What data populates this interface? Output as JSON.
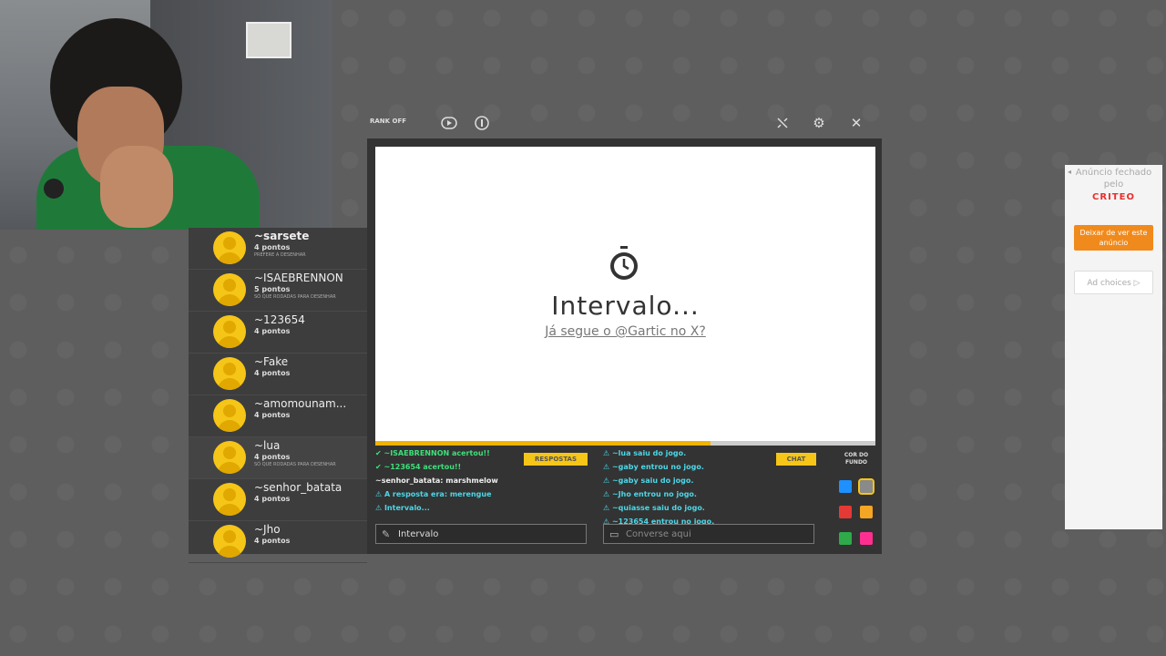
{
  "toolbar": {
    "label": "RANK OFF",
    "icons": [
      "video-icon",
      "info-icon",
      "minimize-icon",
      "gear-icon",
      "close-icon"
    ]
  },
  "players": [
    {
      "name": "~sarsete",
      "points": "4 pontos",
      "sub": "PREFERE A DESENHAR",
      "bold": true
    },
    {
      "name": "~ISAEBRENNON",
      "points": "5 pontos",
      "sub": "SÓ QUE RODADAS PARA DESENHAR"
    },
    {
      "name": "~123654",
      "points": "4 pontos",
      "sub": ""
    },
    {
      "name": "~Fake",
      "points": "4 pontos",
      "sub": ""
    },
    {
      "name": "~amomounam...",
      "points": "4 pontos",
      "sub": ""
    },
    {
      "name": "~lua",
      "points": "4 pontos",
      "sub": "SÓ QUE RODADAS PARA DESENHAR"
    },
    {
      "name": "~senhor_batata",
      "points": "4 pontos",
      "sub": ""
    },
    {
      "name": "~Jho",
      "points": "4 pontos",
      "sub": ""
    }
  ],
  "canvas": {
    "title": "Intervalo...",
    "link": "Já segue o @Gartic no X?",
    "progress_percent": 67
  },
  "answers": {
    "tab_label": "RESPOSTAS",
    "messages": [
      {
        "text": "✔ ~ISAEBRENNON acertou!!",
        "color": "green"
      },
      {
        "text": "✔ ~123654 acertou!!",
        "color": "green"
      },
      {
        "text": "~senhor_batata: marshmelow",
        "color": "white"
      },
      {
        "text": "⚠ A resposta era: merengue",
        "color": "cyan"
      },
      {
        "text": "⚠ Intervalo...",
        "color": "cyan"
      }
    ],
    "input_value": "Intervalo"
  },
  "chat": {
    "tab_label": "CHAT",
    "messages": [
      {
        "text": "⚠ ~lua saiu do jogo.",
        "color": "cyan"
      },
      {
        "text": "⚠ ~gaby entrou no jogo.",
        "color": "cyan"
      },
      {
        "text": "⚠ ~gaby saiu do jogo.",
        "color": "cyan"
      },
      {
        "text": "⚠ ~Jho entrou no jogo.",
        "color": "cyan"
      },
      {
        "text": "⚠ ~quiasse saiu do jogo.",
        "color": "cyan"
      },
      {
        "text": "⚠ ~123654 entrou no jogo.",
        "color": "cyan"
      }
    ],
    "placeholder": "Converse aqui"
  },
  "colors": {
    "label_line1": "COR DO",
    "label_line2": "FUNDO",
    "swatches": [
      "#1e90ff",
      "#8a8a8a",
      "#e53935",
      "#f5a623",
      "#2eaa4a",
      "#ff2f92"
    ]
  },
  "ad": {
    "closed_text": "Anúncio fechado pelo",
    "brand": "CRITEO",
    "stop_button": "Deixar de ver este anúncio",
    "choices": "Ad choices ▷"
  }
}
